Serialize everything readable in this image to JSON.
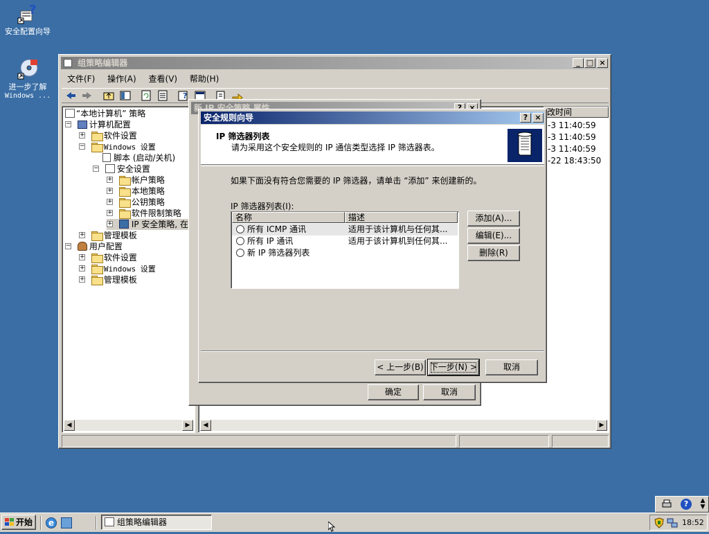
{
  "desktop": {
    "icons": [
      {
        "label": "安全配置向导",
        "icon": "security-wizard-icon"
      },
      {
        "label_line1": "进一步了解",
        "label_line2": "Windows ...",
        "icon": "windows-cd-icon"
      }
    ]
  },
  "gpedit": {
    "title": "组策略编辑器",
    "menu": [
      "文件(F)",
      "操作(A)",
      "查看(V)",
      "帮助(H)"
    ],
    "tree": [
      {
        "label": "“本地计算机” 策略"
      },
      {
        "label": "计算机配置"
      },
      {
        "label": "软件设置"
      },
      {
        "label": "Windows 设置"
      },
      {
        "label": "脚本 (启动/关机)"
      },
      {
        "label": "安全设置"
      },
      {
        "label": "帐户策略"
      },
      {
        "label": "本地策略"
      },
      {
        "label": "公钥策略"
      },
      {
        "label": "软件限制策略"
      },
      {
        "label": "IP 安全策略, 在"
      },
      {
        "label": "管理模板"
      },
      {
        "label": "用户配置"
      },
      {
        "label": "软件设置"
      },
      {
        "label": "Windows 设置"
      },
      {
        "label": "管理模板"
      }
    ],
    "right_column_header": "改时间",
    "right_values": [
      "-3 11:40:59",
      "-3 11:40:59",
      "-3 11:40:59",
      "-22 18:43:50"
    ]
  },
  "props_dialog": {
    "title": "新 IP 安全策略 属性",
    "ok": "确定",
    "cancel": "取消"
  },
  "wizard": {
    "title": "安全规则向导",
    "header_title": "IP 筛选器列表",
    "header_subtitle": "请为采用这个安全规则的 IP 通信类型选择 IP 筛选器表。",
    "instruction": "如果下面没有符合您需要的 IP 筛选器，请单击 “添加” 来创建新的。",
    "list_label": "IP 筛选器列表(I):",
    "columns": [
      "名称",
      "描述"
    ],
    "rows": [
      {
        "name": "所有 ICMP 通讯",
        "desc": "适用于该计算机与任何其..."
      },
      {
        "name": "所有 IP 通讯",
        "desc": "适用于该计算机到任何其..."
      },
      {
        "name": "新 IP 筛选器列表",
        "desc": ""
      }
    ],
    "add": "添加(A)...",
    "edit": "编辑(E)...",
    "remove": "删除(R)",
    "back": "< 上一步(B)",
    "next": "下一步(N) >",
    "cancel": "取消"
  },
  "taskbar": {
    "start": "开始",
    "task": "组策略编辑器",
    "clock": "18:52"
  },
  "colors": {
    "desktop": "#3a6ea5",
    "title_active": "#0a246a",
    "title_inactive": "#808080",
    "face": "#d4d0c8"
  }
}
